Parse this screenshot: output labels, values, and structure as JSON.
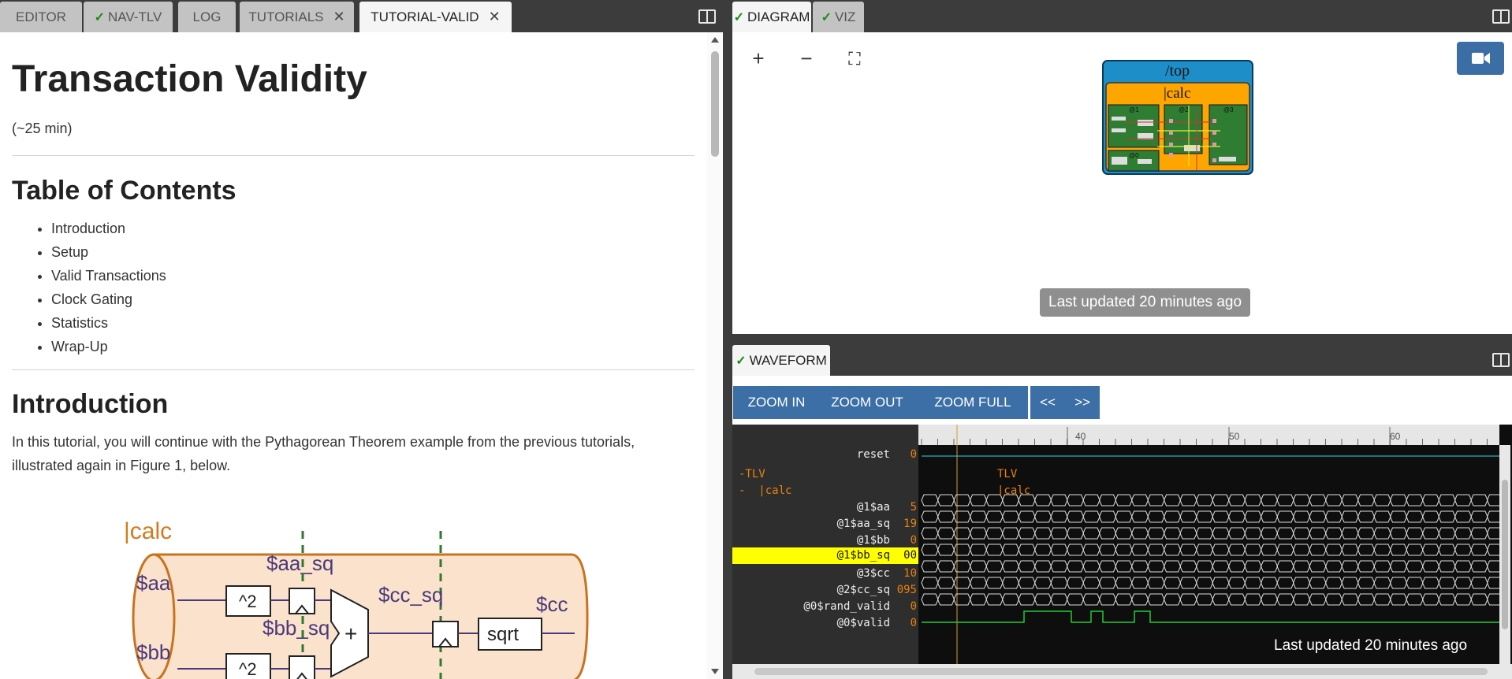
{
  "left_tabs": [
    {
      "label": "EDITOR",
      "check": false,
      "close": false
    },
    {
      "label": "NAV-TLV",
      "check": true,
      "close": false
    },
    {
      "label": "LOG",
      "check": false,
      "close": false
    },
    {
      "label": "TUTORIALS",
      "check": false,
      "close": true
    },
    {
      "label": "TUTORIAL-VALID",
      "check": false,
      "close": true,
      "active": true
    }
  ],
  "doc": {
    "title": "Transaction Validity",
    "duration": "(~25 min)",
    "toc_heading": "Table of Contents",
    "toc": [
      "Introduction",
      "Setup",
      "Valid Transactions",
      "Clock Gating",
      "Statistics",
      "Wrap-Up"
    ],
    "intro_heading": "Introduction",
    "intro_text": "In this tutorial, you will continue with the Pythagorean Theorem example from the previous tutorials, illustrated again in Figure 1, below.",
    "figure": {
      "scope": "|calc",
      "aa": "$aa",
      "bb": "$bb",
      "aa_sq": "$aa_sq",
      "bb_sq": "$bb_sq",
      "cc_sq": "$cc_sq",
      "cc": "$cc",
      "sq": "^2",
      "plus": "+",
      "sqrt": "sqrt"
    }
  },
  "right_top_tabs": [
    {
      "label": "DIAGRAM",
      "check": true,
      "active": true
    },
    {
      "label": "VIZ",
      "check": true
    }
  ],
  "diagram": {
    "zoom_in": "+",
    "zoom_out": "−",
    "fit": "⛶",
    "top": "/top",
    "calc": "|calc",
    "stages": [
      "@1",
      "@2",
      "@3",
      "@0"
    ],
    "updated": "Last updated 20 minutes ago"
  },
  "waveform_tab": {
    "label": "WAVEFORM",
    "check": true
  },
  "wave_buttons": {
    "zoom_in": "ZOOM IN",
    "zoom_out": "ZOOM OUT",
    "zoom_full": "ZOOM FULL",
    "prev": "<<",
    "next": ">>"
  },
  "timeline": {
    "ticks": [
      "40",
      "50",
      "60"
    ]
  },
  "signals": [
    {
      "name": "reset",
      "value": "0"
    },
    {
      "name": "-TLV",
      "value": "",
      "kind": "scope"
    },
    {
      "name": "-  |calc",
      "value": "",
      "kind": "scope"
    },
    {
      "name": "@1$aa",
      "value": "5"
    },
    {
      "name": "@1$aa_sq",
      "value": "19"
    },
    {
      "name": "@1$bb",
      "value": "0"
    },
    {
      "name": "@1$bb_sq",
      "value": "00",
      "highlight": true
    },
    {
      "name": "@3$cc",
      "value": "10"
    },
    {
      "name": "@2$cc_sq",
      "value": "095"
    },
    {
      "name": "@0$rand_valid",
      "value": "0"
    },
    {
      "name": "@0$valid",
      "value": "0"
    }
  ],
  "wave_labels": {
    "tlv": "TLV",
    "calc": "|calc"
  },
  "wave_updated": "Last updated 20 minutes ago",
  "colors": {
    "accent": "#3b6fa5",
    "check": "#1a8a1a",
    "orange": "#e8820c",
    "cyan": "#2fd4e8",
    "highlight": "#ffff00",
    "green_wave": "#22cc33"
  }
}
